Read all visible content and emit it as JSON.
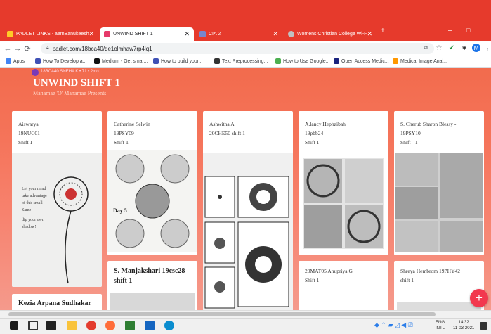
{
  "browser": {
    "tabs": [
      {
        "label": "PADLET LINKS - aemBanukeesh",
        "active": false,
        "color": "#ffca28"
      },
      {
        "label": "UNWIND SHIFT 1",
        "active": true,
        "color": "#e63a6a"
      },
      {
        "label": "CIA 2",
        "active": false,
        "color": "#7986cb"
      },
      {
        "label": "Womens Christian College Wi-F",
        "active": false,
        "color": "#c0c0c0"
      }
    ],
    "new_tab": "+",
    "minimize": "–",
    "maximize": "□",
    "url": "padlet.com/18bca40/de1olmhaw7rp4lq1",
    "profile_initial": "M",
    "bookmarks": [
      {
        "label": "Apps",
        "color": "#4285f4"
      },
      {
        "label": "How To Develop a...",
        "color": "#3f51b5"
      },
      {
        "label": "Medium - Get smar...",
        "color": "#111"
      },
      {
        "label": "How to build your...",
        "color": "#3f51b5"
      },
      {
        "label": "Text Preprocessing...",
        "color": "#333"
      },
      {
        "label": "How to Use Google...",
        "color": "#4caf50"
      },
      {
        "label": "Open Access Medic...",
        "color": "#1a237e"
      },
      {
        "label": "Medical Image Anal...",
        "color": "#ff9800"
      }
    ]
  },
  "padlet": {
    "author": "18BCA40 SNEHA K  •  71  •  2mo",
    "title": "UNWIND SHIFT 1",
    "subtitle": "Manamae 'O' Manamae Presents",
    "cards": [
      {
        "line1": "Aiswarya",
        "line2": "19NUC01",
        "line3": "Shift 1"
      },
      {
        "line1": "Catherine Selwin",
        "line2": "19PSY09",
        "line3": "Shift-1"
      },
      {
        "line1": "Ashwitha A",
        "line2": "20CHE50 shift 1",
        "line3": ""
      },
      {
        "line1": "A.lancy Hephzibah",
        "line2": "19pbb24",
        "line3": "Shift 1"
      },
      {
        "line1": "S. Cherub Sharon Blessy -",
        "line2": "19PSY10",
        "line3": "Shift - 1"
      },
      {
        "line1": "S. Manjakshari 19csc28",
        "line2": "shift 1",
        "line3": ""
      },
      {
        "line1": "20MAT05 Anupriya G",
        "line2": "Shift 1",
        "line3": ""
      },
      {
        "line1": "Shreya Hembrom 19PHY42",
        "line2": "shift 1",
        "line3": ""
      },
      {
        "line1": "Kezia Arpana Sudhakar",
        "line2": "",
        "line3": ""
      }
    ],
    "fab": "+"
  },
  "taskbar": {
    "lang": "ENG",
    "locale": "INTL",
    "time": "14:32",
    "date": "11-03-2021"
  }
}
